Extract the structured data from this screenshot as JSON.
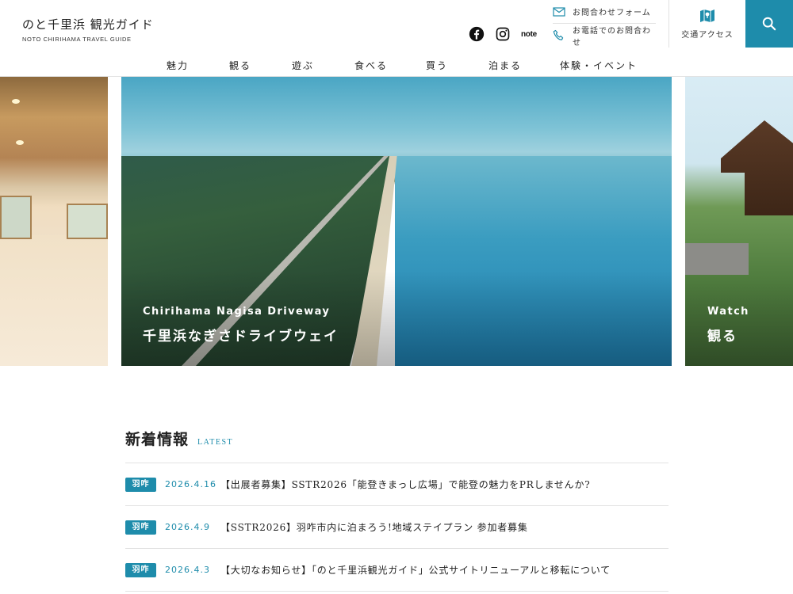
{
  "header": {
    "logo_jp": "のと千里浜 観光ガイド",
    "logo_en": "NOTO CHIRIHAMA TRAVEL GUIDE",
    "social": {
      "note_label": "note"
    },
    "contact_form_label": "お問合わせフォーム",
    "contact_phone_label": "お電話でのお問合わせ",
    "access_label": "交通アクセス",
    "accent_color": "#1e8cab"
  },
  "nav": {
    "items": [
      {
        "label": "魅力"
      },
      {
        "label": "観る"
      },
      {
        "label": "遊ぶ"
      },
      {
        "label": "食べる"
      },
      {
        "label": "買う"
      },
      {
        "label": "泊まる"
      },
      {
        "label": "体験・イベント"
      }
    ]
  },
  "slider": {
    "main": {
      "title_en": "Chirihama Nagisa Driveway",
      "title_jp": "千里浜なぎさドライブウェイ"
    },
    "next": {
      "title_en": "Watch",
      "title_jp": "観る"
    }
  },
  "news": {
    "title": "新着情報",
    "subtitle": "LATEST",
    "items": [
      {
        "tag": "羽咋",
        "date": "2026.4.16",
        "text": "【出展者募集】SSTR2026「能登きまっし広場」で能登の魅力をPRしませんか?"
      },
      {
        "tag": "羽咋",
        "date": "2026.4.9",
        "text": "【SSTR2026】羽咋市内に泊まろう!地域ステイプラン 参加者募集"
      },
      {
        "tag": "羽咋",
        "date": "2026.4.3",
        "text": "【大切なお知らせ】「のと千里浜観光ガイド」公式サイトリニューアルと移転について"
      }
    ]
  }
}
